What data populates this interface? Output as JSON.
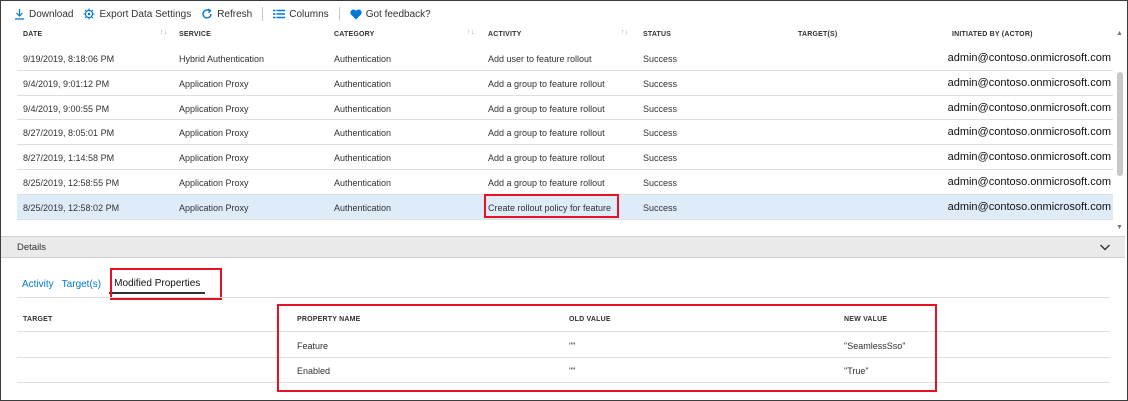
{
  "toolbar": {
    "download": "Download",
    "export": "Export Data Settings",
    "refresh": "Refresh",
    "columns": "Columns",
    "feedback": "Got feedback?"
  },
  "table": {
    "headers": {
      "date": "DATE",
      "service": "SERVICE",
      "category": "CATEGORY",
      "activity": "ACTIVITY",
      "status": "STATUS",
      "targets": "TARGET(S)",
      "actor": "INITIATED BY (ACTOR)"
    },
    "rows": [
      {
        "date": "9/19/2019, 8:18:06 PM",
        "service": "Hybrid Authentication",
        "category": "Authentication",
        "activity": "Add user to feature rollout",
        "status": "Success",
        "actor": "admin@contoso.onmicrosoft.com"
      },
      {
        "date": "9/4/2019, 9:01:12 PM",
        "service": "Application Proxy",
        "category": "Authentication",
        "activity": "Add a group to feature rollout",
        "status": "Success",
        "actor": "admin@contoso.onmicrosoft.com"
      },
      {
        "date": "9/4/2019, 9:00:55 PM",
        "service": "Application Proxy",
        "category": "Authentication",
        "activity": "Add a group to feature rollout",
        "status": "Success",
        "actor": "admin@contoso.onmicrosoft.com"
      },
      {
        "date": "8/27/2019, 8:05:01 PM",
        "service": "Application Proxy",
        "category": "Authentication",
        "activity": "Add a group to feature rollout",
        "status": "Success",
        "actor": "admin@contoso.onmicrosoft.com"
      },
      {
        "date": "8/27/2019, 1:14:58 PM",
        "service": "Application Proxy",
        "category": "Authentication",
        "activity": "Add a group to feature rollout",
        "status": "Success",
        "actor": "admin@contoso.onmicrosoft.com"
      },
      {
        "date": "8/25/2019, 12:58:55 PM",
        "service": "Application Proxy",
        "category": "Authentication",
        "activity": "Add a group to feature rollout",
        "status": "Success",
        "actor": "admin@contoso.onmicrosoft.com"
      },
      {
        "date": "8/25/2019, 12:58:02 PM",
        "service": "Application Proxy",
        "category": "Authentication",
        "activity": "Create rollout policy for feature",
        "status": "Success",
        "actor": "admin@contoso.onmicrosoft.com"
      }
    ]
  },
  "details": {
    "title": "Details",
    "tabs": [
      "Activity",
      "Target(s)",
      "Modified Properties"
    ],
    "active_tab": "Modified Properties"
  },
  "properties": {
    "headers": {
      "target": "TARGET",
      "property_name": "PROPERTY NAME",
      "old_value": "OLD VALUE",
      "new_value": "NEW VALUE"
    },
    "rows": [
      {
        "property_name": "Feature",
        "old_value": "\"\"",
        "new_value": "\"SeamlessSso\""
      },
      {
        "property_name": "Enabled",
        "old_value": "\"\"",
        "new_value": "\"True\""
      }
    ]
  },
  "colors": {
    "accent": "#0078d4",
    "selected_row": "#deecf9",
    "highlight": "#e81123"
  }
}
